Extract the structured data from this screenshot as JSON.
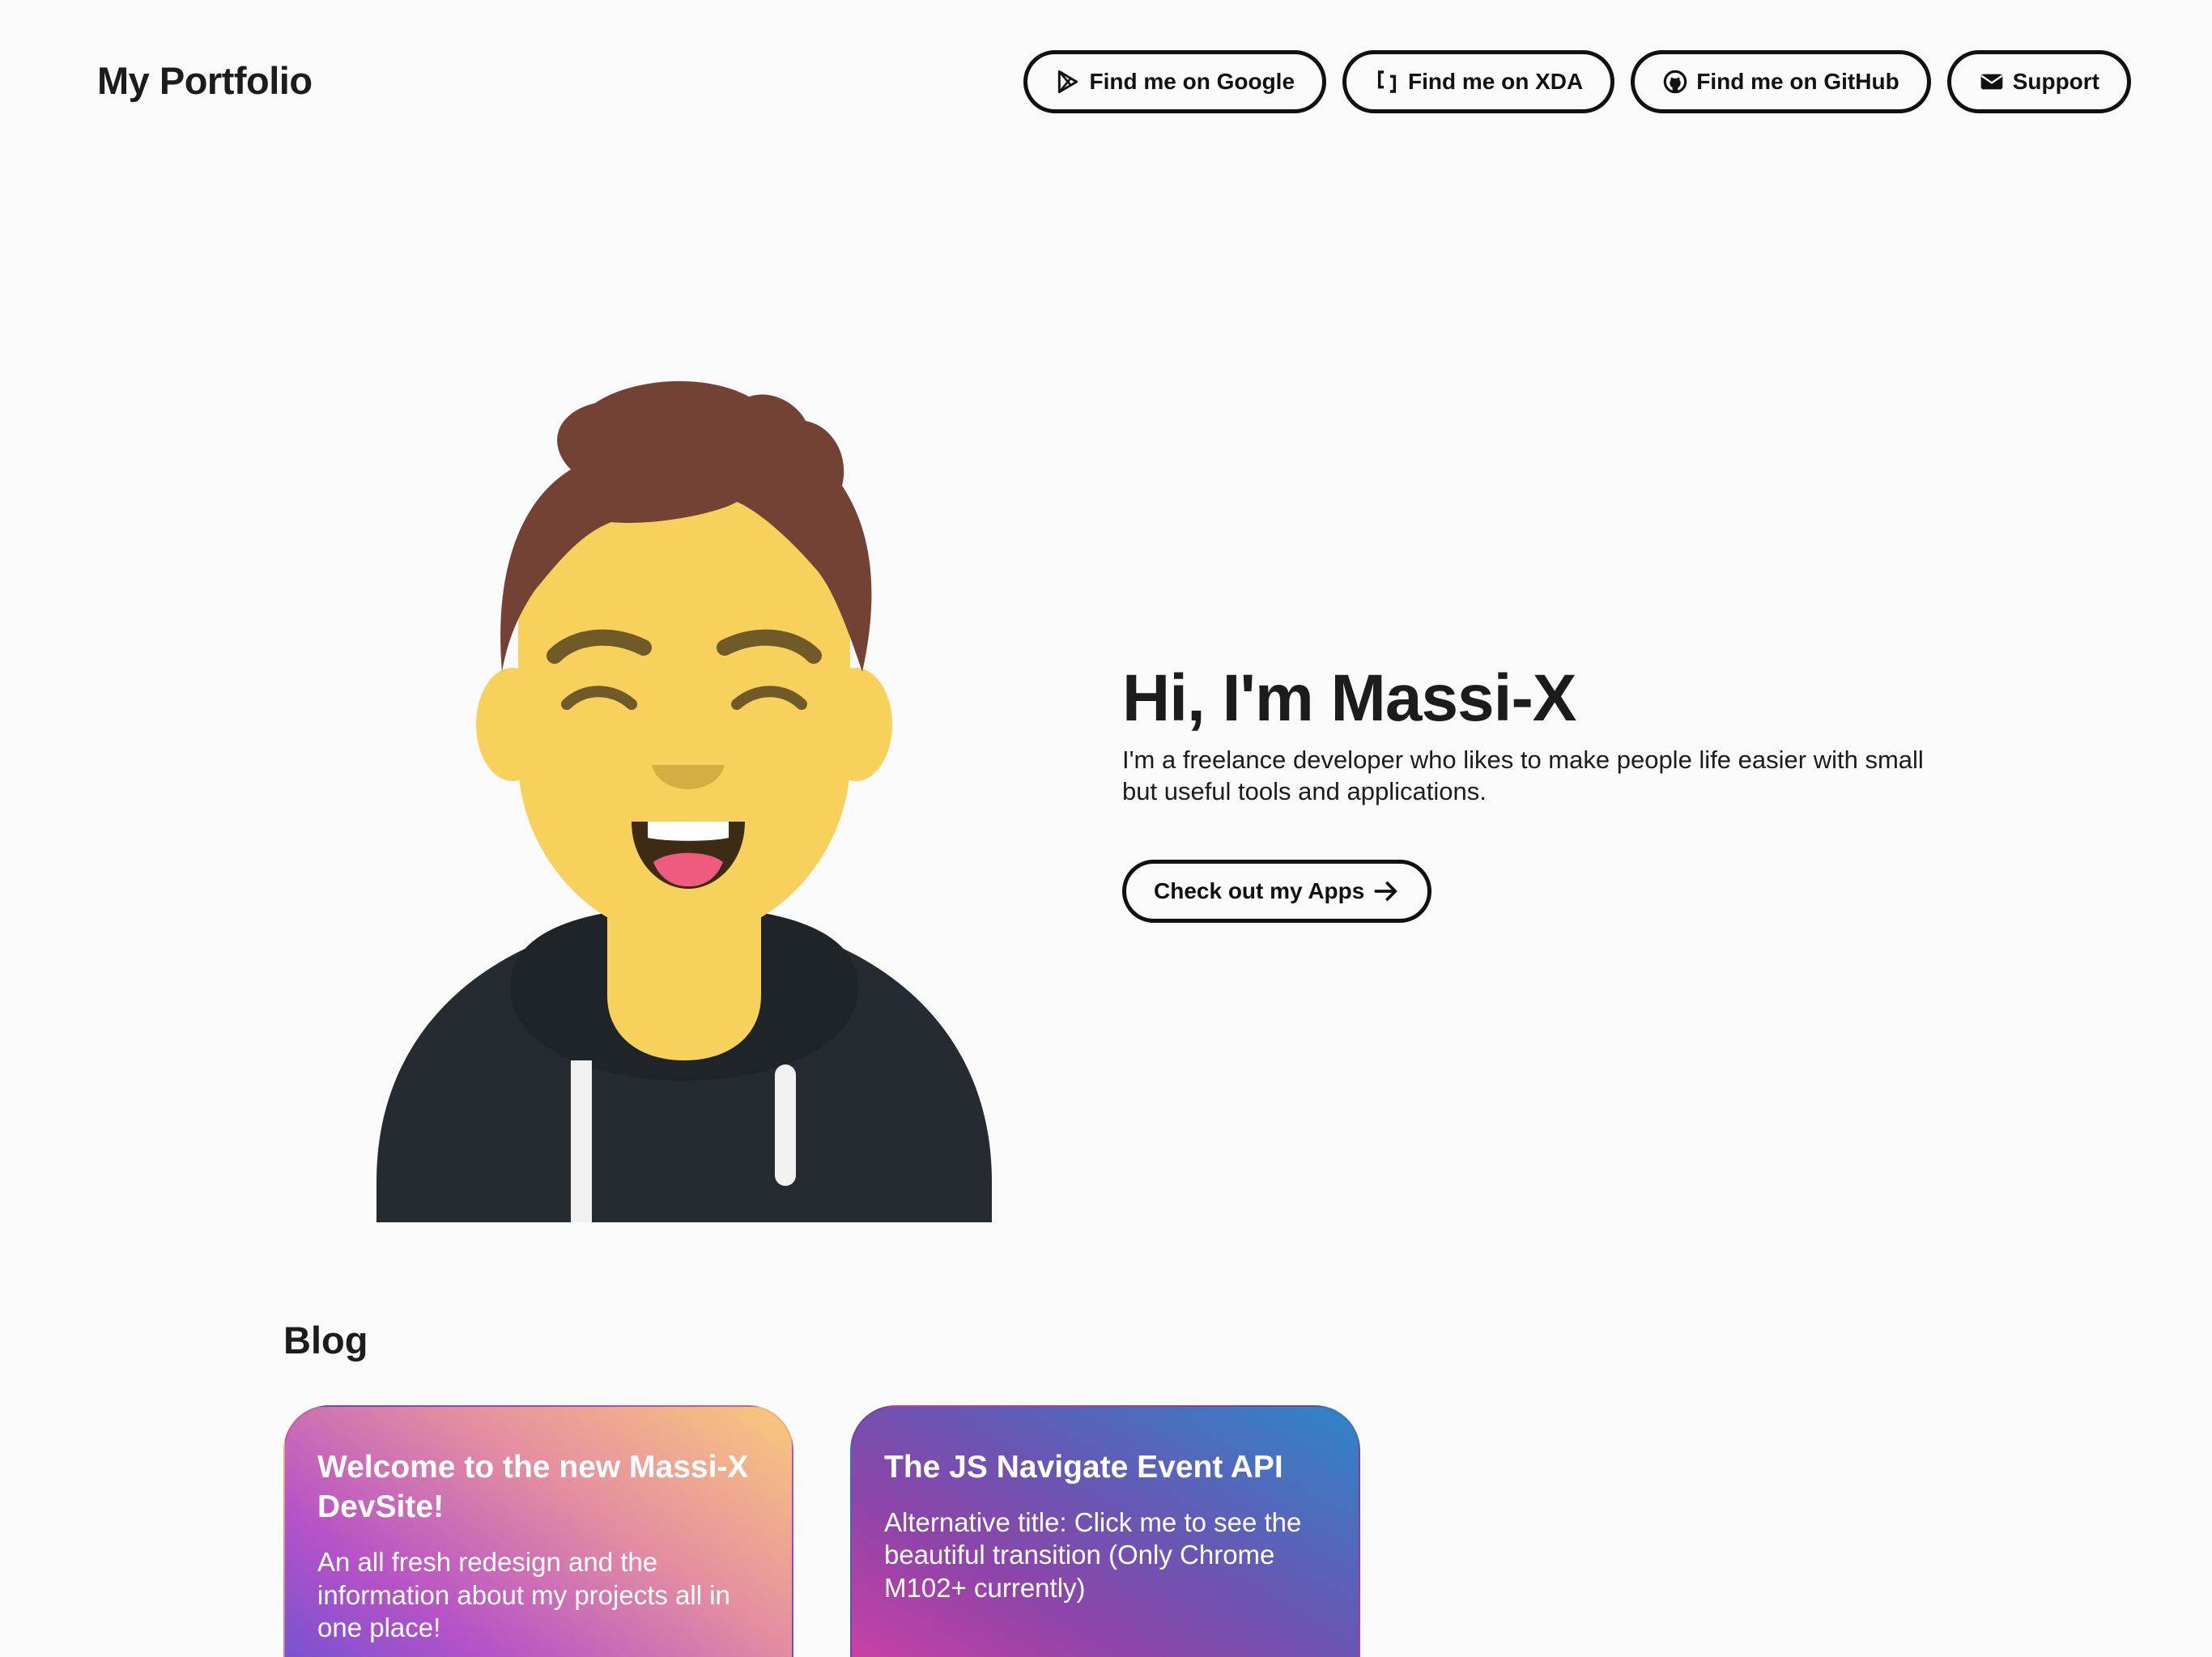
{
  "header": {
    "brand": "My Portfolio",
    "links": [
      {
        "label": "Find me on Google",
        "icon": "google-play-icon"
      },
      {
        "label": "Find me on XDA",
        "icon": "xda-icon"
      },
      {
        "label": "Find me on GitHub",
        "icon": "github-icon"
      },
      {
        "label": "Support",
        "icon": "envelope-icon"
      }
    ]
  },
  "hero": {
    "title": "Hi, I'm Massi-X",
    "text": "I'm a freelance developer who likes to make people life easier with small but useful tools and applications.",
    "cta_label": "Check out my Apps",
    "cta_icon": "arrow-right-icon"
  },
  "blog": {
    "title": "Blog",
    "posts": [
      {
        "title": "Welcome to the new Massi-X DevSite!",
        "description": "An all fresh redesign and the information about my projects all in one place!"
      },
      {
        "title": "The JS Navigate Event API",
        "description": "Alternative title: Click me to see the beautiful transition (Only Chrome M102+ currently)"
      }
    ]
  },
  "colors": {
    "background": "#fafafa",
    "text": "#1c1c1c",
    "skin": "#f8d05c",
    "hair": "#744234",
    "hoodie": "#252b30"
  }
}
